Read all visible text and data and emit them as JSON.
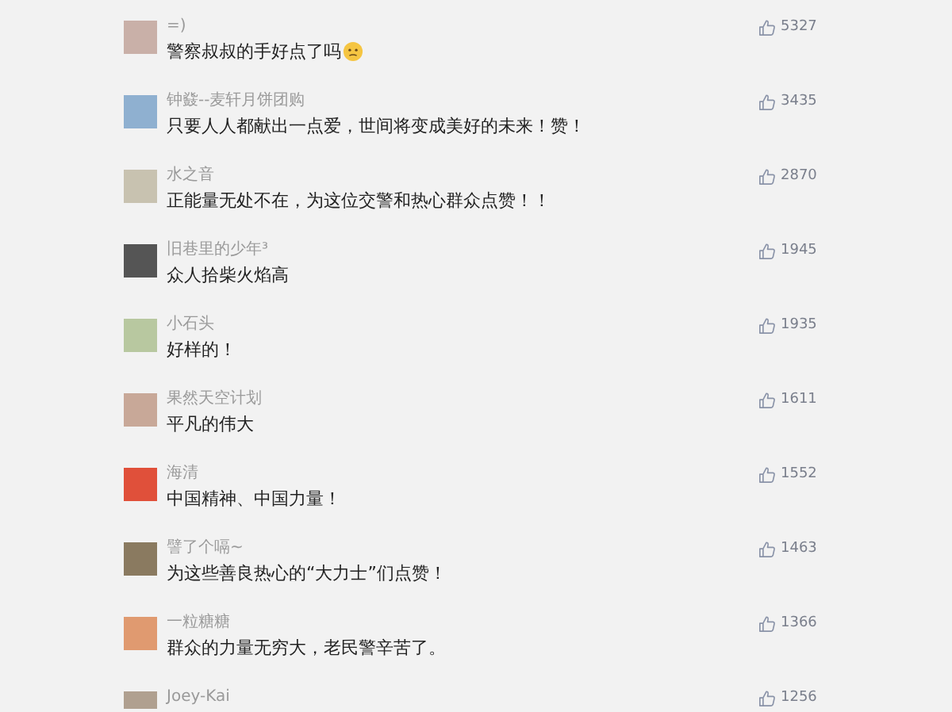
{
  "comments": [
    {
      "username": "=)",
      "text": "警察叔叔的手好点了吗",
      "emoji": true,
      "likes": "5327"
    },
    {
      "username": "钟鼗--麦轩月饼团购",
      "text": "只要人人都献出一点爱，世间将变成美好的未来！赞！",
      "emoji": false,
      "likes": "3435"
    },
    {
      "username": "水之音",
      "text": "正能量无处不在，为这位交警和热心群众点赞！！",
      "emoji": false,
      "likes": "2870"
    },
    {
      "username": "旧巷里的少年³",
      "text": "众人拾柴火焰高",
      "emoji": false,
      "likes": "1945"
    },
    {
      "username": "小石头",
      "text": "好样的！",
      "emoji": false,
      "likes": "1935"
    },
    {
      "username": "果然天空计划",
      "text": "平凡的伟大",
      "emoji": false,
      "likes": "1611"
    },
    {
      "username": "海清",
      "text": "中国精神、中国力量！",
      "emoji": false,
      "likes": "1552"
    },
    {
      "username": "譬了个嗝~",
      "text": "为这些善良热心的“大力士”们点赞！",
      "emoji": false,
      "likes": "1463"
    },
    {
      "username": "一粒糖糖",
      "text": "群众的力量无穷大，老民警辛苦了。",
      "emoji": false,
      "likes": "1366"
    },
    {
      "username": "Joey-Kai",
      "likes": "1256"
    }
  ]
}
